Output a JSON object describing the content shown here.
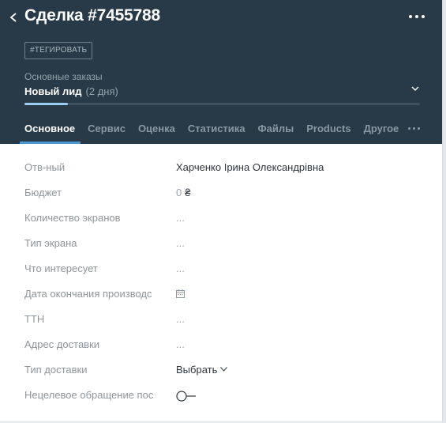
{
  "deal": {
    "title": "Сделка #7455788",
    "tag_button": "#ТЕГИРОВАТЬ",
    "pipeline": "Основные заказы",
    "stage": "Новый лид",
    "stage_days": "(2 дня)",
    "progress_fraction": 0.11
  },
  "tabs": [
    {
      "label": "Основное"
    },
    {
      "label": "Сервис"
    },
    {
      "label": "Оценка"
    },
    {
      "label": "Статистика"
    },
    {
      "label": "Файлы"
    },
    {
      "label": "Products"
    },
    {
      "label": "Другое"
    }
  ],
  "fields": {
    "responsible": {
      "label": "Отв-ный",
      "value": "Харченко Ірина Олександрівна"
    },
    "budget": {
      "label": "Бюджет",
      "value": "0",
      "currency": "₴"
    },
    "screens_count": {
      "label": "Количество экранов",
      "value": "..."
    },
    "screen_type": {
      "label": "Тип экрана",
      "value": "..."
    },
    "interest": {
      "label": "Что интересует",
      "value": "..."
    },
    "production_end": {
      "label": "Дата окончания производс"
    },
    "ttn": {
      "label": "ТТН",
      "value": "..."
    },
    "delivery_address": {
      "label": "Адрес доставки",
      "value": "..."
    },
    "delivery_type": {
      "label": "Тип доставки",
      "value": "Выбрать"
    },
    "untargeted": {
      "label": "Нецелевое обращение пос"
    }
  },
  "colors": {
    "header_bg": "#283a47",
    "accent": "#4a98d4",
    "progress_fill": "#9ccaf0"
  },
  "icons": {
    "back": "chevron-left-icon",
    "more": "more-horizontal-icon",
    "stage": "chevron-down-icon",
    "date": "calendar-icon",
    "toggle": "toggle-off-icon"
  }
}
